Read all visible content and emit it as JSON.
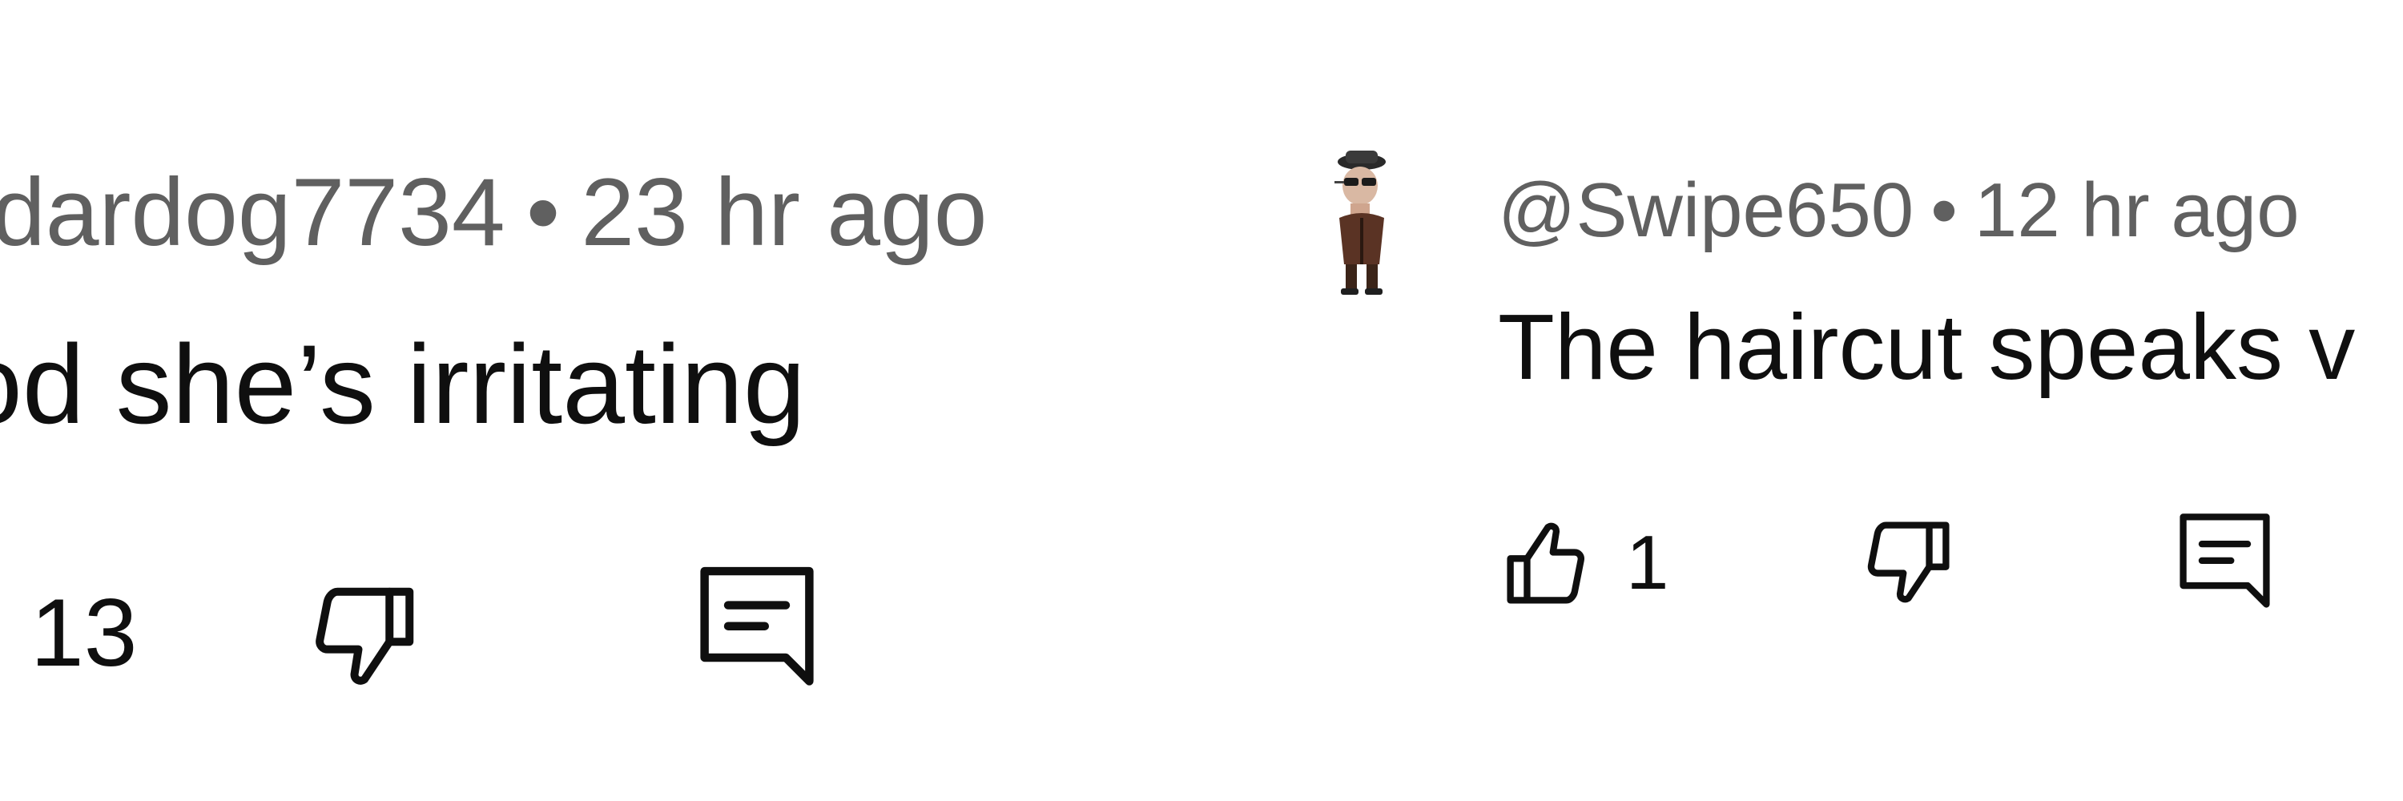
{
  "comments": [
    {
      "author": "dardog7734",
      "separator": "•",
      "time": "23 hr ago",
      "text": "od she’s irritating",
      "likes": "13",
      "icons": {
        "dislike": "thumbs-down-icon",
        "reply": "reply-comment-icon"
      }
    },
    {
      "author": "@Swipe650",
      "separator": "•",
      "time": "12 hr ago",
      "text": "The haircut speaks v",
      "likes": "1",
      "icons": {
        "avatar": "avatar-image",
        "like": "thumbs-up-icon",
        "dislike": "thumbs-down-icon",
        "reply": "reply-comment-icon"
      }
    }
  ],
  "colors": {
    "meta_text": "#606060",
    "body_text": "#0f0f0f",
    "icon_stroke": "#0f0f0f",
    "background": "#ffffff"
  }
}
